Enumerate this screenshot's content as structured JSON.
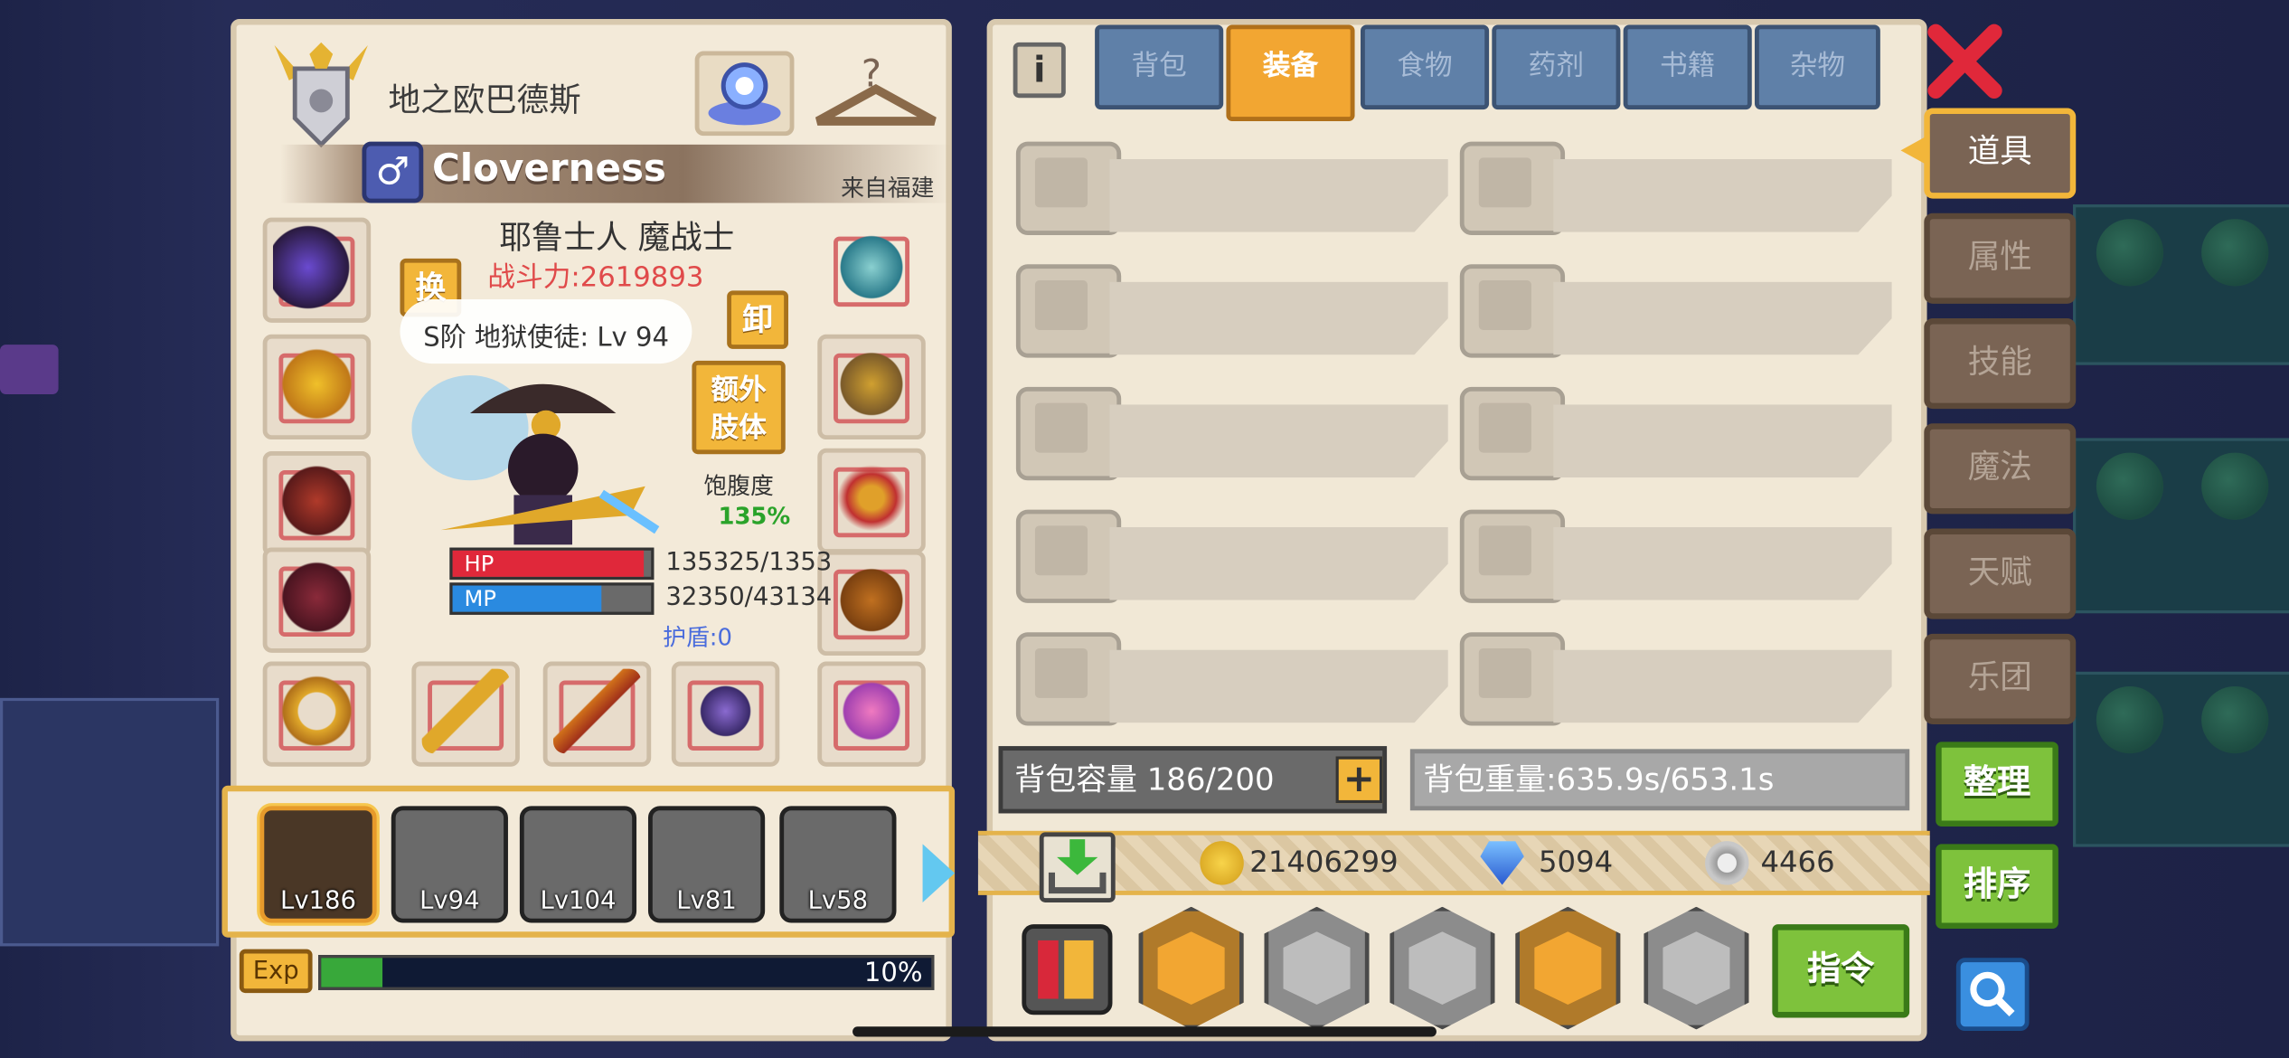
{
  "player": {
    "rank_title": "地之欧巴德斯",
    "gender_symbol": "♂",
    "name": "Cloverness",
    "origin": "来自福建",
    "race_class": "耶鲁士人 魔战士",
    "combat_power": "战斗力:2619893",
    "pet_stage": "S阶 地狱使徒: Lv 94",
    "swap_label": "换",
    "unequip_label": "卸",
    "extra_limb_label": "额外\n肢体",
    "satiety_label": "饱腹度",
    "satiety_value": "135%",
    "hp_label": "HP",
    "hp_value": "135325/1353",
    "hp_fill": 0.96,
    "mp_label": "MP",
    "mp_value": "32350/43134",
    "mp_fill": 0.75,
    "shield": "护盾:0"
  },
  "party": [
    {
      "level": "Lv186",
      "selected": true
    },
    {
      "level": "Lv94",
      "selected": false
    },
    {
      "level": "Lv104",
      "selected": false
    },
    {
      "level": "Lv81",
      "selected": false
    },
    {
      "level": "Lv58",
      "selected": false
    }
  ],
  "exp": {
    "label": "Exp",
    "percent": "10%",
    "fill": 0.1
  },
  "inventory": {
    "info_icon": "i",
    "tabs": [
      {
        "label": "背包",
        "active": false
      },
      {
        "label": "装备",
        "active": true
      },
      {
        "label": "食物",
        "active": false
      },
      {
        "label": "药剂",
        "active": false
      },
      {
        "label": "书籍",
        "active": false
      },
      {
        "label": "杂物",
        "active": false
      }
    ],
    "capacity": "背包容量 186/200",
    "capacity_plus": "+",
    "weight": "背包重量:635.9s/653.1s",
    "gold": "21406299",
    "diamond": "5094",
    "silver": "4466",
    "command_label": "指令"
  },
  "side_tabs": [
    {
      "label": "道具",
      "active": true
    },
    {
      "label": "属性",
      "active": false
    },
    {
      "label": "技能",
      "active": false
    },
    {
      "label": "魔法",
      "active": false
    },
    {
      "label": "天赋",
      "active": false
    },
    {
      "label": "乐团",
      "active": false
    }
  ],
  "side_buttons": {
    "organize": "整理",
    "sort": "排序"
  },
  "colors": {
    "accent": "#f2a632",
    "tab_blue": "#5f80a8",
    "green_button": "#7ec23c",
    "power_red": "#e04a4a"
  }
}
